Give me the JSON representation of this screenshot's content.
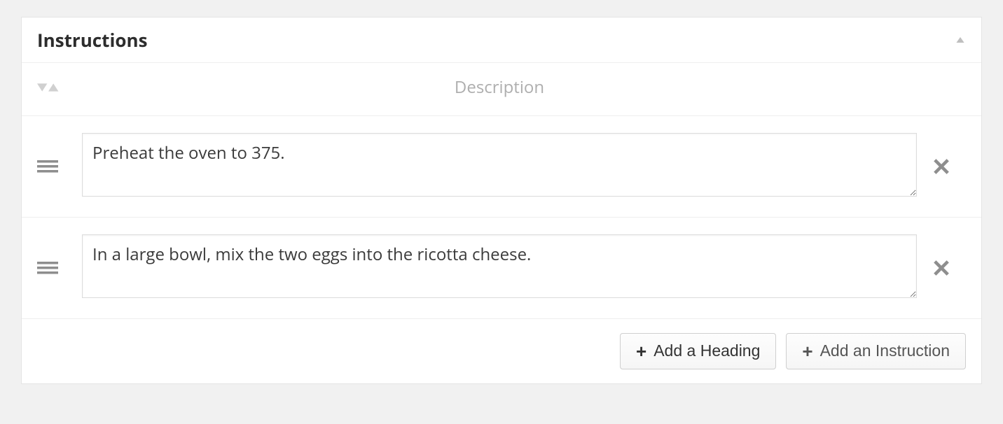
{
  "panel": {
    "title": "Instructions",
    "column_label": "Description"
  },
  "instructions": [
    {
      "text": "Preheat the oven to 375."
    },
    {
      "text": "In a large bowl, mix the two eggs into the ricotta cheese."
    }
  ],
  "buttons": {
    "add_heading": "Add a Heading",
    "add_instruction": "Add an Instruction"
  }
}
